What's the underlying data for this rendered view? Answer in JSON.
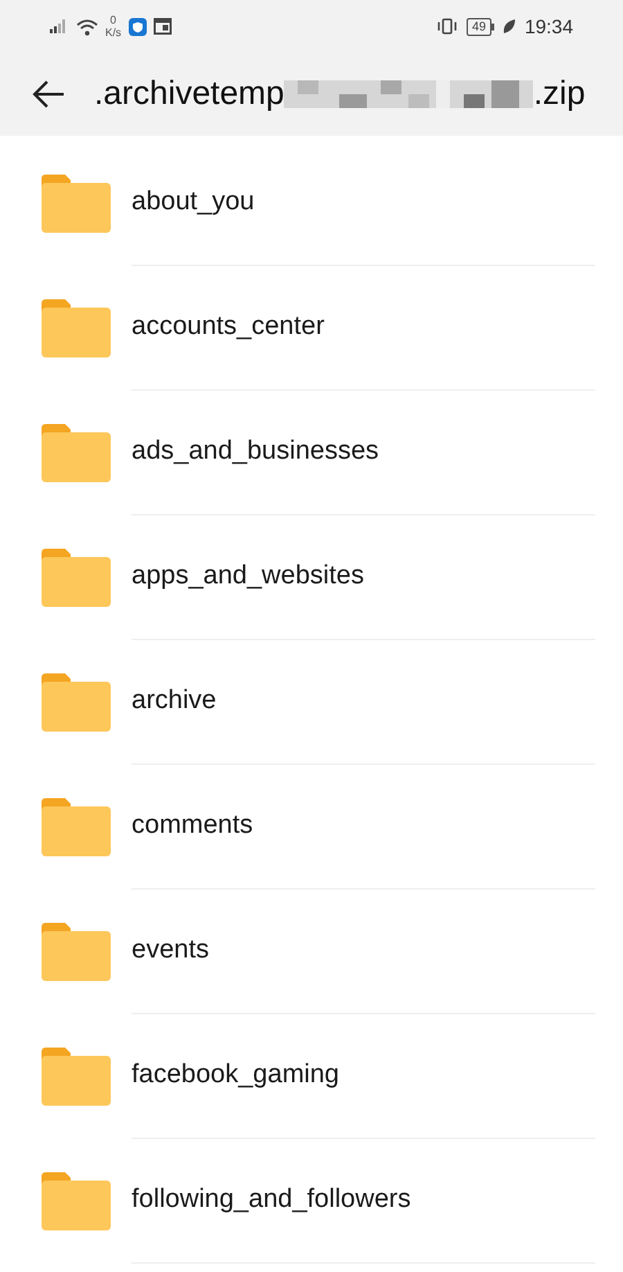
{
  "status_bar": {
    "net_speed_value": "0",
    "net_speed_unit": "K/s",
    "battery": "49",
    "time": "19:34"
  },
  "header": {
    "title_start": ".archivetemp",
    "title_end": ".zip"
  },
  "folders": [
    {
      "name": "about_you"
    },
    {
      "name": "accounts_center"
    },
    {
      "name": "ads_and_businesses"
    },
    {
      "name": "apps_and_websites"
    },
    {
      "name": "archive"
    },
    {
      "name": "comments"
    },
    {
      "name": "events"
    },
    {
      "name": "facebook_gaming"
    },
    {
      "name": "following_and_followers"
    }
  ]
}
